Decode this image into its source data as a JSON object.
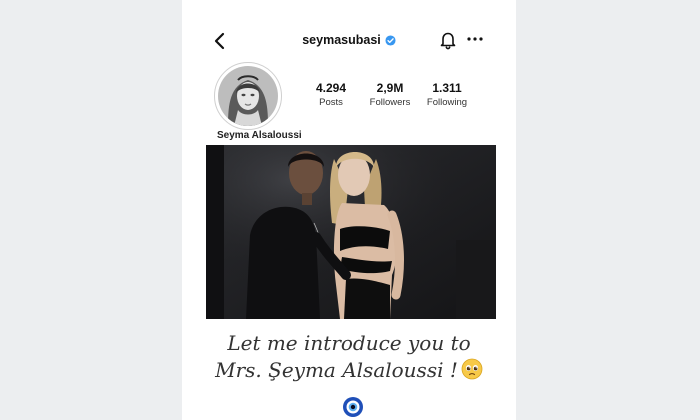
{
  "profile": {
    "username": "seymasubasi",
    "full_name": "Seyma Alsaloussi"
  },
  "stats": [
    {
      "value": "4.294",
      "label": "Posts"
    },
    {
      "value": "2,9M",
      "label": "Followers"
    },
    {
      "value": "1.311",
      "label": "Following"
    }
  ],
  "caption": {
    "line1": "Let me introduce you to",
    "line2": "Mrs. Şeyma Alsaloussi !"
  },
  "icons": [
    "back-arrow-icon",
    "verified-badge-icon",
    "bell-icon",
    "more-icon",
    "pleading-face-emoji-icon",
    "evil-eye-icon"
  ],
  "colors": {
    "verified": "#3897f0",
    "background": "#eceef0"
  }
}
